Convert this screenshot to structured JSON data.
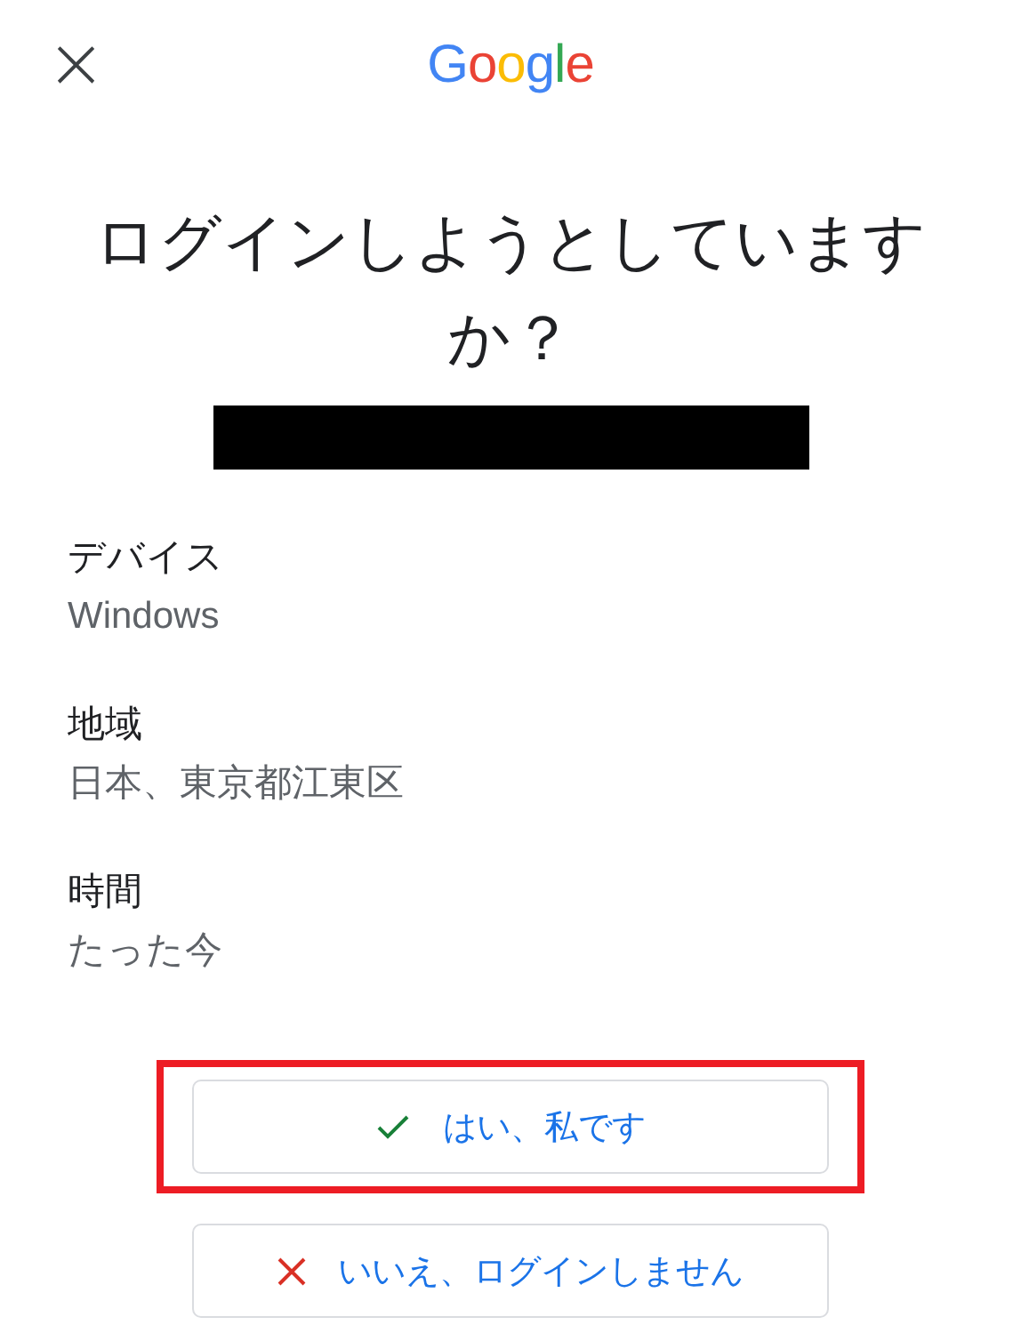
{
  "header": {
    "close": "×",
    "logo": "Google"
  },
  "title": "ログインしようとしていますか？",
  "details": [
    {
      "label": "デバイス",
      "value": "Windows"
    },
    {
      "label": "地域",
      "value": "日本、東京都江東区"
    },
    {
      "label": "時間",
      "value": "たった今"
    }
  ],
  "buttons": [
    {
      "kind": "confirm",
      "label": "はい、私です",
      "highlighted": true
    },
    {
      "kind": "deny",
      "label": "いいえ、ログインしません",
      "highlighted": false
    }
  ]
}
